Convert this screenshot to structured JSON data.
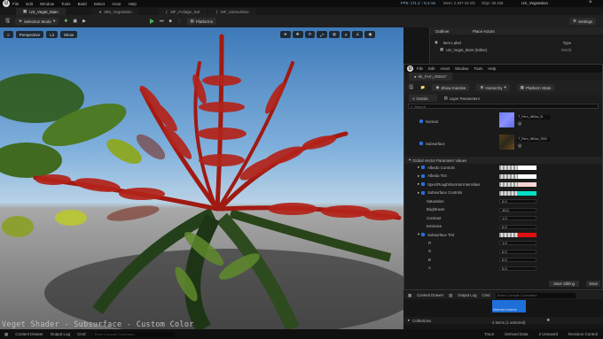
{
  "top_menu": {
    "items": [
      "File",
      "Edit",
      "Window",
      "Tools",
      "Build",
      "Select",
      "Actor",
      "Help"
    ],
    "project": "US_Veget_Main",
    "fps": "FPS: 171.2 :: 8.4 ms",
    "mem": "Mem: 2,937.33 mb",
    "objs": "Objs: 39,158",
    "tab_right": "US_Vegetation"
  },
  "doc_tabs": [
    {
      "label": "US_Veget_Main"
    },
    {
      "label": "MM_Vegetation"
    },
    {
      "label": "MF_Foliage_Set"
    },
    {
      "label": "MF_Subsurface"
    }
  ],
  "toolbar": {
    "mode": "Selection Mode",
    "platforms": "Platforms",
    "settings": "Settings"
  },
  "viewport": {
    "perspective": "Perspective",
    "lit": "Lit",
    "show": "Show",
    "caption": "Veget Shader - Subsurface - Custom Color"
  },
  "outliner": {
    "title": "Outliner",
    "place": "Place Actors",
    "item_label": "Item Label",
    "type": "Type",
    "level": "US_Veget_Main (Editor)",
    "world": "World"
  },
  "instance": {
    "menu": [
      "File",
      "Edit",
      "Asset",
      "Window",
      "Tools",
      "Help"
    ],
    "tab": "MI_Fern_rNDsv*",
    "show_inactive": "Show Inactive",
    "hierarchy": "Hierarchy",
    "platform_stats": "Platform Stats",
    "details": "Details",
    "layer_params": "Layer Parameters",
    "search": "Search",
    "normal_label": "Normal",
    "normal_tex": "T_Fern_rNDsv_N",
    "subsurface_label": "Subsurface",
    "subsurface_tex": "T_Fern_rNDsv_SSS",
    "group": "Global Vector Parameter Values",
    "vec_params": [
      {
        "label": "Albedo Controls",
        "color": "#ffffff"
      },
      {
        "label": "Albedo Tint",
        "color": "#ffffff"
      },
      {
        "label": "Spec/Rough/Normal Intensities",
        "color": "#f6d3d3"
      },
      {
        "label": "Subsurface Controls",
        "color": "#00e0c8"
      }
    ],
    "sub_params": [
      {
        "label": "Saturation",
        "value": "0.0"
      },
      {
        "label": "Brightness",
        "value": "10.0"
      },
      {
        "label": "Contrast",
        "value": "1.0"
      },
      {
        "label": "Emissive",
        "value": "0.0"
      }
    ],
    "tint_label": "Subsurface Tint",
    "tint_color": "#e01010",
    "rgba": [
      {
        "label": "R",
        "value": "1.0"
      },
      {
        "label": "G",
        "value": "0.0"
      },
      {
        "label": "B",
        "value": "0.0"
      },
      {
        "label": "A",
        "value": "0.0"
      }
    ],
    "save_sibling": "Save Sibling",
    "save_child": "Save"
  },
  "bottom": {
    "content_drawer": "Content Drawer",
    "output_log": "Output Log",
    "cmd": "Cmd",
    "console_placeholder": "Enter Console Command",
    "collections": "Collections",
    "asset_label": "Material Instance",
    "items": "4 items (1 selected)"
  },
  "status": {
    "content_drawer": "Content Drawer",
    "output_log": "Output Log",
    "cmd": "Cmd",
    "console_placeholder": "Enter Console Command",
    "trace": "Trace",
    "derived": "Derived Data",
    "unsaved": "2 Unsaved",
    "revision": "Revision Control"
  }
}
